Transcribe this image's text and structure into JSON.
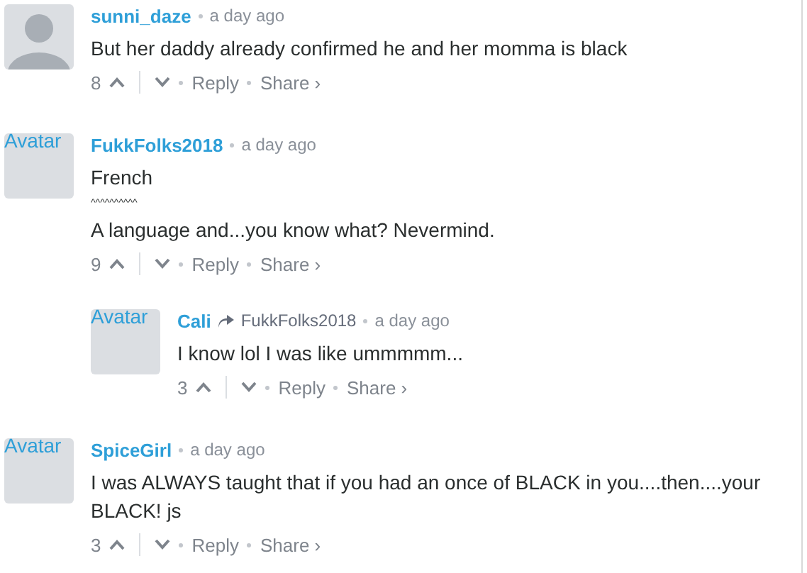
{
  "comments": [
    {
      "avatar": {
        "kind": "silhouette"
      },
      "author": "sunni_daze",
      "time": "a day ago",
      "paragraphs": [
        {
          "kind": "text",
          "text": "But her daddy already confirmed he and her momma is black"
        }
      ],
      "votes": "8",
      "actions": [
        "Reply",
        "Share ›"
      ]
    },
    {
      "avatar": {
        "kind": "broken",
        "alt": "Avatar"
      },
      "author": "FukkFolks2018",
      "time": "a day ago",
      "paragraphs": [
        {
          "kind": "text",
          "text": "French"
        },
        {
          "kind": "small",
          "text": "^^^^^^^^^^"
        },
        {
          "kind": "text",
          "text": "A language and...you know what? Nevermind."
        }
      ],
      "votes": "9",
      "actions": [
        "Reply",
        "Share ›"
      ],
      "children": [
        {
          "avatar": {
            "kind": "broken",
            "alt": "Avatar"
          },
          "author": "Cali",
          "reply_to": "FukkFolks2018",
          "time": "a day ago",
          "paragraphs": [
            {
              "kind": "text",
              "text": "I know lol I was like ummmmm..."
            }
          ],
          "votes": "3",
          "actions": [
            "Reply",
            "Share ›"
          ]
        }
      ]
    },
    {
      "avatar": {
        "kind": "broken",
        "alt": "Avatar"
      },
      "author": "SpiceGirl",
      "time": "a day ago",
      "paragraphs": [
        {
          "kind": "text",
          "text": "I was ALWAYS taught that if you had an once of BLACK in you....then....your BLACK! js"
        }
      ],
      "votes": "3",
      "actions": [
        "Reply",
        "Share ›"
      ]
    }
  ]
}
